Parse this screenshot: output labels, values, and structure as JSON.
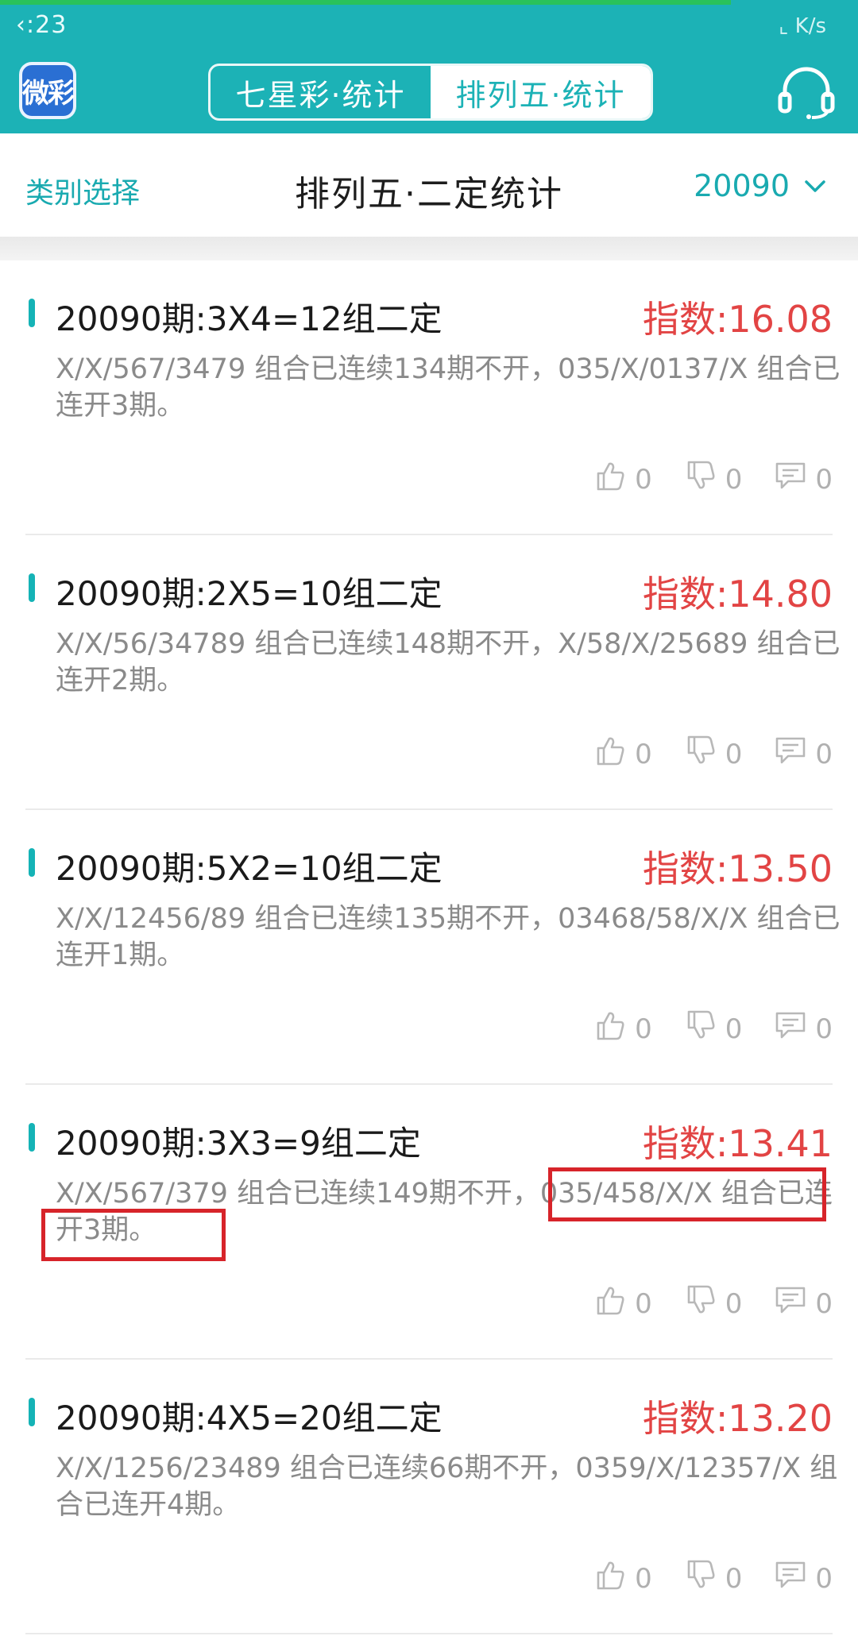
{
  "status": {
    "time": "‹:23",
    "right": "⌞ K/s"
  },
  "app": {
    "logo_text": "微彩"
  },
  "tabs": [
    {
      "label": "七星彩·统计",
      "active": false
    },
    {
      "label": "排列五·统计",
      "active": true
    }
  ],
  "subheader": {
    "left": "类别选择",
    "title": "排列五·二定统计",
    "issue": "20090"
  },
  "items": [
    {
      "title": "20090期:3X4=12组二定",
      "index": "指数:16.08",
      "desc": "X/X/567/3479 组合已连续134期不开，035/X/0137/X 组合已连开3期。",
      "likes": "0",
      "dislikes": "0",
      "comments": "0"
    },
    {
      "title": "20090期:2X5=10组二定",
      "index": "指数:14.80",
      "desc": "X/X/56/34789 组合已连续148期不开，X/58/X/25689 组合已连开2期。",
      "likes": "0",
      "dislikes": "0",
      "comments": "0"
    },
    {
      "title": "20090期:5X2=10组二定",
      "index": "指数:13.50",
      "desc": "X/X/12456/89 组合已连续135期不开，03468/58/X/X 组合已连开1期。",
      "likes": "0",
      "dislikes": "0",
      "comments": "0"
    },
    {
      "title": "20090期:3X3=9组二定",
      "index": "指数:13.41",
      "desc": "X/X/567/379 组合已连续149期不开，035/458/X/X 组合已连开3期。",
      "likes": "0",
      "dislikes": "0",
      "comments": "0"
    },
    {
      "title": "20090期:4X5=20组二定",
      "index": "指数:13.20",
      "desc": "X/X/1256/23489 组合已连续66期不开，0359/X/12357/X 组合已连开4期。",
      "likes": "0",
      "dislikes": "0",
      "comments": "0"
    }
  ],
  "colors": {
    "header": "#1cb2b6",
    "accent": "#19aab0",
    "index_red": "#e24444",
    "highlight": "#d7242a"
  }
}
